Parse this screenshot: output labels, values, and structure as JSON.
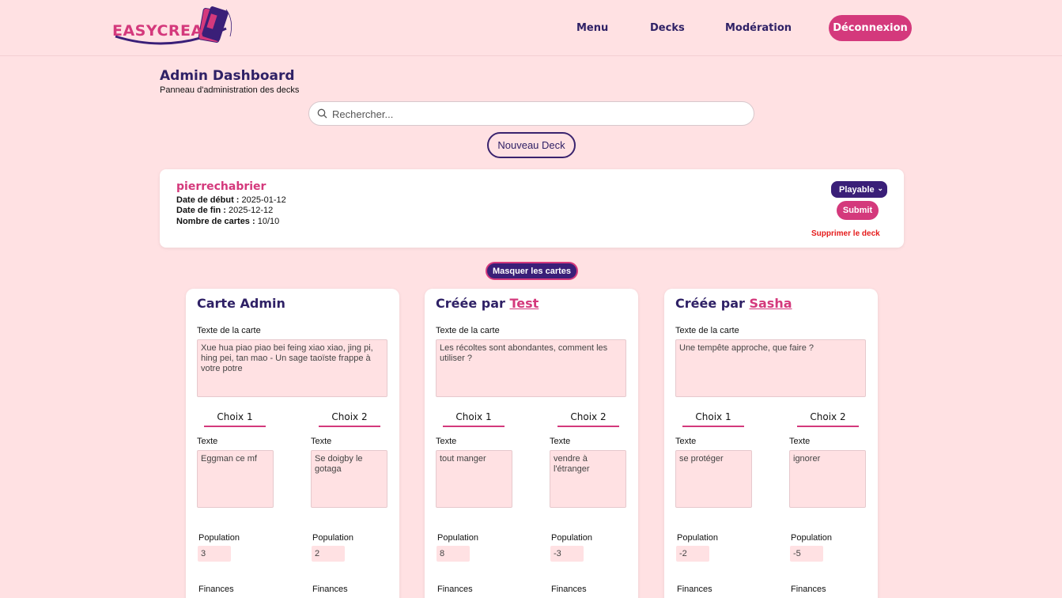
{
  "header": {
    "logo_text": "EASYCREA",
    "nav": [
      "Menu",
      "Decks",
      "Modération"
    ],
    "logout_label": "Déconnexion"
  },
  "page": {
    "title": "Admin Dashboard",
    "subtitle": "Panneau d'administration des decks",
    "search_placeholder": "Rechercher...",
    "new_deck_label": "Nouveau Deck",
    "hide_cards_label": "Masquer les cartes"
  },
  "deck": {
    "name": "pierrechabrier",
    "start_label": "Date de début :",
    "start_value": "2025-01-12",
    "end_label": "Date de fin :",
    "end_value": "2025-12-12",
    "count_label": "Nombre de cartes :",
    "count_value": "10/10",
    "status": "Playable",
    "submit_label": "Submit",
    "delete_label": "Supprimer le deck"
  },
  "cards": [
    {
      "title": "Carte Admin",
      "author": "",
      "text_label": "Texte de la carte",
      "text": "Xue hua piao piao bei feing xiao xiao, jing pi, hing pei, tan mao - Un sage taoïste frappe à votre potre",
      "choice1": {
        "head": "Choix 1",
        "text_label": "Texte",
        "text": "Eggman ce mf",
        "pop_label": "Population",
        "pop": "3",
        "fin_label": "Finances"
      },
      "choice2": {
        "head": "Choix 2",
        "text_label": "Texte",
        "text": "Se doigby le gotaga",
        "pop_label": "Population",
        "pop": "2",
        "fin_label": "Finances"
      }
    },
    {
      "title": "Créée par",
      "author": "Test",
      "text_label": "Texte de la carte",
      "text": "Les récoltes sont abondantes, comment les utiliser ?",
      "choice1": {
        "head": "Choix 1",
        "text_label": "Texte",
        "text": "tout manger",
        "pop_label": "Population",
        "pop": "8",
        "fin_label": "Finances"
      },
      "choice2": {
        "head": "Choix 2",
        "text_label": "Texte",
        "text": "vendre à l'étranger",
        "pop_label": "Population",
        "pop": "-3",
        "fin_label": "Finances"
      }
    },
    {
      "title": "Créée par",
      "author": "Sasha",
      "text_label": "Texte de la carte",
      "text": "Une tempête approche, que faire ?",
      "choice1": {
        "head": "Choix 1",
        "text_label": "Texte",
        "text": "se protéger",
        "pop_label": "Population",
        "pop": "-2",
        "fin_label": "Finances"
      },
      "choice2": {
        "head": "Choix 2",
        "text_label": "Texte",
        "text": "ignorer",
        "pop_label": "Population",
        "pop": "-5",
        "fin_label": "Finances"
      }
    }
  ]
}
